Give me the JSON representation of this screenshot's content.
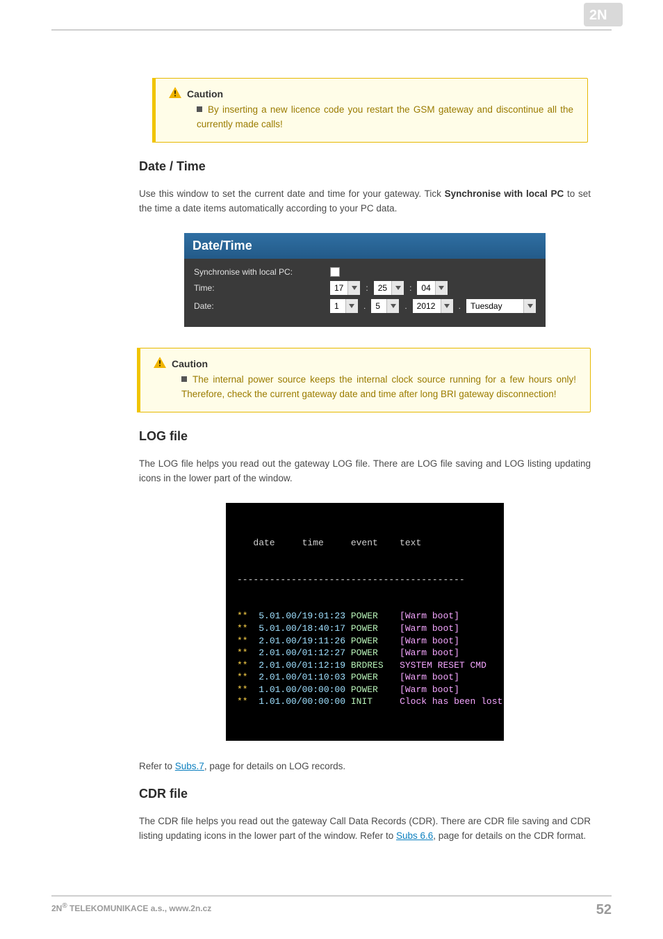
{
  "logo_alt": "2N",
  "caution1": {
    "title": "Caution",
    "body": "By inserting a new licence code you restart the GSM gateway and discontinue all the currently made calls!"
  },
  "section_datetime": {
    "heading": "Date / Time",
    "para_pre": "Use this window to set the current date and time for your gateway. Tick ",
    "para_bold": "Synchronise with local PC",
    "para_post": " to set the time a date items automatically according to your PC data."
  },
  "datetime_panel": {
    "title": "Date/Time",
    "rows": {
      "sync_label": "Synchronise with local PC:",
      "time_label": "Time:",
      "date_label": "Date:",
      "hh": "17",
      "mm": "25",
      "ss": "04",
      "d": "1",
      "m": "5",
      "y": "2012",
      "dow": "Tuesday",
      "colon": ":",
      "dot": "."
    }
  },
  "caution2": {
    "title": "Caution",
    "body": "The internal power source keeps the internal clock source running for a few hours only! Therefore, check the current gateway date and time after long BRI gateway disconnection!"
  },
  "section_log": {
    "heading": "LOG file",
    "para": "The LOG file helps you read out the gateway LOG file. There are LOG file saving and LOG listing updating icons in the lower part of the window."
  },
  "log_panel": {
    "header": "   date     time     event    text",
    "dashes": "------------------------------------------",
    "rows": [
      {
        "stars": "**",
        "dt": "  5.01.00/19:01:23",
        "evt": " POWER  ",
        "txt": "  [Warm boot]"
      },
      {
        "stars": "**",
        "dt": "  5.01.00/18:40:17",
        "evt": " POWER  ",
        "txt": "  [Warm boot]"
      },
      {
        "stars": "**",
        "dt": "  2.01.00/19:11:26",
        "evt": " POWER  ",
        "txt": "  [Warm boot]"
      },
      {
        "stars": "**",
        "dt": "  2.01.00/01:12:27",
        "evt": " POWER  ",
        "txt": "  [Warm boot]"
      },
      {
        "stars": "**",
        "dt": "  2.01.00/01:12:19",
        "evt": " BRDRES ",
        "txt": "  SYSTEM RESET CMD"
      },
      {
        "stars": "**",
        "dt": "  2.01.00/01:10:03",
        "evt": " POWER  ",
        "txt": "  [Warm boot]"
      },
      {
        "stars": "**",
        "dt": "  1.01.00/00:00:00",
        "evt": " POWER  ",
        "txt": "  [Warm boot]"
      },
      {
        "stars": "**",
        "dt": "  1.01.00/00:00:00",
        "evt": " INIT   ",
        "txt": "  Clock has been lost"
      }
    ]
  },
  "log_ref": {
    "pre": "Refer to ",
    "link": "Subs.7",
    "post": ", page for details on LOG records."
  },
  "section_cdr": {
    "heading": "CDR file",
    "para_pre": "The CDR file helps you read out the gateway Call Data Records (CDR). There are CDR file saving and CDR listing updating icons in the lower part of the window. Refer to ",
    "link": "Subs 6.6",
    "para_post": ", page for details on the CDR format."
  },
  "footer": {
    "left_pre": "2N",
    "left_sup": "®",
    "left_post": " TELEKOMUNIKACE a.s., www.2n.cz",
    "page": "52"
  }
}
